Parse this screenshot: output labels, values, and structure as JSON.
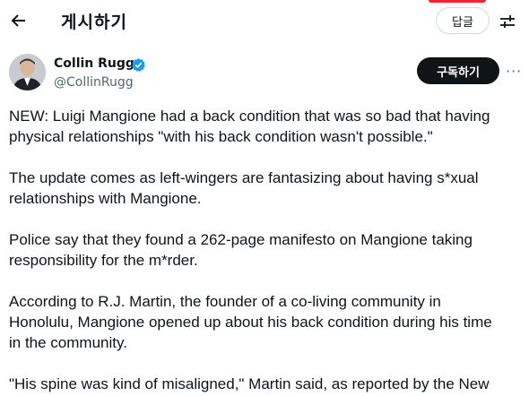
{
  "header": {
    "back_icon": "arrow-left-icon",
    "title": "게시하기",
    "reply_label": "답글",
    "filter_icon": "sliders-icon",
    "accent_color": "#f4212e"
  },
  "author": {
    "name": "Collin Rugg",
    "handle": "@CollinRugg",
    "verified_icon": "verified-badge-icon",
    "verified_color": "#1d9bf0",
    "subscribe_label": "구독하기",
    "more_label": "···"
  },
  "tweet": {
    "lines": [
      "NEW: Luigi Mangione had a back condition that was so bad that having",
      "physical relationships \"with his back condition wasn't possible.\"",
      "The update comes as left-wingers are fantasizing about having s*xual",
      "relationships with Mangione.",
      "Police say that they found a 262-page manifesto on Mangione taking",
      "responsibility for the m*rder.",
      "According to R.J. Martin, the founder of a co-living community in",
      "Honolulu, Mangione opened up about his back condition during his time",
      "in the community.",
      "\"His spine was kind of misaligned,\" Martin said, as reported by the New"
    ]
  }
}
